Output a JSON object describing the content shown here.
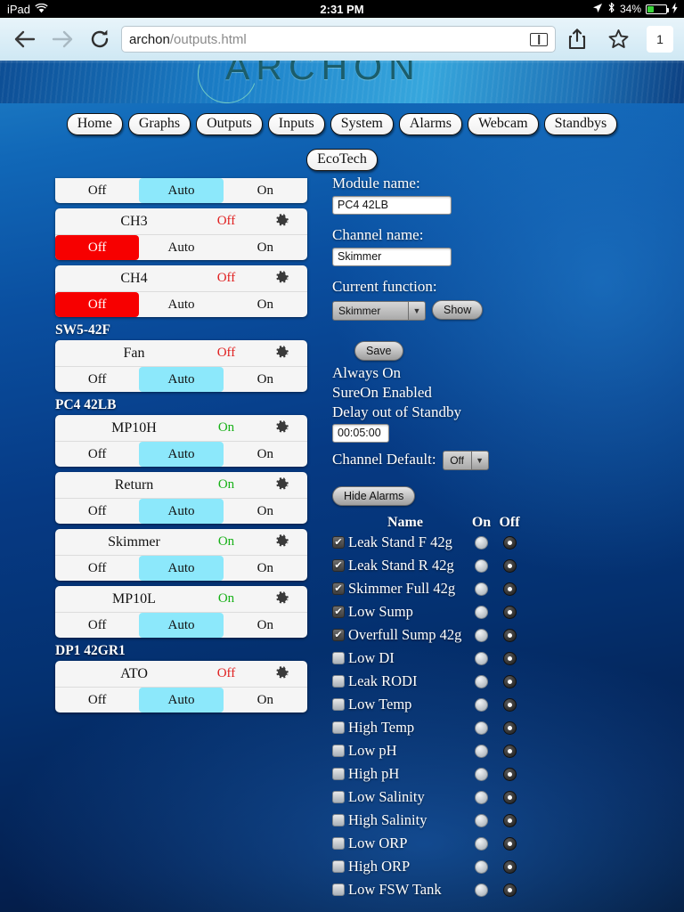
{
  "status_bar": {
    "device": "iPad",
    "wifi_icon": "wifi-icon",
    "time": "2:31 PM",
    "location_icon": "location-arrow-icon",
    "bluetooth_icon": "bluetooth-icon",
    "battery_percent": "34%",
    "battery_level": 34,
    "charging_icon": "lightning-bolt-icon"
  },
  "browser": {
    "back_icon": "back-arrow-icon",
    "forward_icon": "forward-arrow-icon",
    "reload_icon": "reload-icon",
    "url_host": "archon",
    "url_path": "/outputs.html",
    "reader_icon": "reader-view-icon",
    "share_icon": "share-icon",
    "bookmark_icon": "bookmark-star-icon",
    "tab_count": "1"
  },
  "site": {
    "logo_text": "ARCHON",
    "nav_primary": [
      {
        "label": "Home"
      },
      {
        "label": "Graphs"
      },
      {
        "label": "Outputs"
      },
      {
        "label": "Inputs"
      },
      {
        "label": "System"
      },
      {
        "label": "Alarms"
      },
      {
        "label": "Webcam"
      },
      {
        "label": "Standbys"
      }
    ],
    "nav_secondary": [
      {
        "label": "EcoTech"
      }
    ]
  },
  "modes": {
    "off": "Off",
    "auto": "Auto",
    "on": "On"
  },
  "channels": [
    {
      "group": null,
      "clipped": true,
      "name": "",
      "state": "",
      "state_color": "",
      "selected": "auto",
      "show_header": false
    },
    {
      "group": null,
      "clipped": false,
      "name": "CH3",
      "state": "Off",
      "state_color": "off",
      "selected": "off",
      "show_header": true
    },
    {
      "group": null,
      "clipped": false,
      "name": "CH4",
      "state": "Off",
      "state_color": "off",
      "selected": "off",
      "show_header": true
    },
    {
      "group": "SW5-42F",
      "clipped": false,
      "name": "Fan",
      "state": "Off",
      "state_color": "off",
      "selected": "auto",
      "show_header": true
    },
    {
      "group": "PC4 42LB",
      "clipped": false,
      "name": "MP10H",
      "state": "On",
      "state_color": "on",
      "selected": "auto",
      "show_header": true
    },
    {
      "group": null,
      "clipped": false,
      "name": "Return",
      "state": "On",
      "state_color": "on",
      "selected": "auto",
      "show_header": true
    },
    {
      "group": null,
      "clipped": false,
      "name": "Skimmer",
      "state": "On",
      "state_color": "on",
      "selected": "auto",
      "show_header": true
    },
    {
      "group": null,
      "clipped": false,
      "name": "MP10L",
      "state": "On",
      "state_color": "on",
      "selected": "auto",
      "show_header": true
    },
    {
      "group": "DP1 42GR1",
      "clipped": false,
      "name": "ATO",
      "state": "Off",
      "state_color": "off",
      "selected": "auto",
      "show_header": true
    }
  ],
  "detail": {
    "module_name_label": "Module name:",
    "module_name_value": "PC4 42LB",
    "channel_name_label": "Channel name:",
    "channel_name_value": "Skimmer",
    "current_function_label": "Current function:",
    "current_function_value": "Skimmer",
    "show_button": "Show",
    "save_button": "Save",
    "always_on": "Always On",
    "sureon_enabled": "SureOn Enabled",
    "delay_label": "Delay out of Standby",
    "delay_value": "00:05:00",
    "channel_default_label": "Channel Default:",
    "channel_default_value": "Off",
    "hide_alarms_button": "Hide Alarms"
  },
  "alarms": {
    "header": {
      "name": "Name",
      "on": "On",
      "off": "Off"
    },
    "rows": [
      {
        "label": "Leak Stand F 42g",
        "enabled": true,
        "state": "off"
      },
      {
        "label": "Leak Stand R 42g",
        "enabled": true,
        "state": "off"
      },
      {
        "label": "Skimmer Full 42g",
        "enabled": true,
        "state": "off"
      },
      {
        "label": "Low Sump",
        "enabled": true,
        "state": "off"
      },
      {
        "label": "Overfull Sump 42g",
        "enabled": true,
        "state": "off"
      },
      {
        "label": "Low DI",
        "enabled": false,
        "state": "off"
      },
      {
        "label": "Leak RODI",
        "enabled": false,
        "state": "off"
      },
      {
        "label": "Low Temp",
        "enabled": false,
        "state": "off"
      },
      {
        "label": "High Temp",
        "enabled": false,
        "state": "off"
      },
      {
        "label": "Low pH",
        "enabled": false,
        "state": "off"
      },
      {
        "label": "High pH",
        "enabled": false,
        "state": "off"
      },
      {
        "label": "Low Salinity",
        "enabled": false,
        "state": "off"
      },
      {
        "label": "High Salinity",
        "enabled": false,
        "state": "off"
      },
      {
        "label": "Low ORP",
        "enabled": false,
        "state": "off"
      },
      {
        "label": "High ORP",
        "enabled": false,
        "state": "off"
      },
      {
        "label": "Low FSW Tank",
        "enabled": false,
        "state": "off"
      }
    ],
    "checkmark_glyph": "✔"
  },
  "colors": {
    "selected_auto": "#8ce8fb",
    "selected_off": "#f70000",
    "state_on": "#18b118",
    "state_off": "#e02020",
    "battery_green": "#3ad63a"
  }
}
